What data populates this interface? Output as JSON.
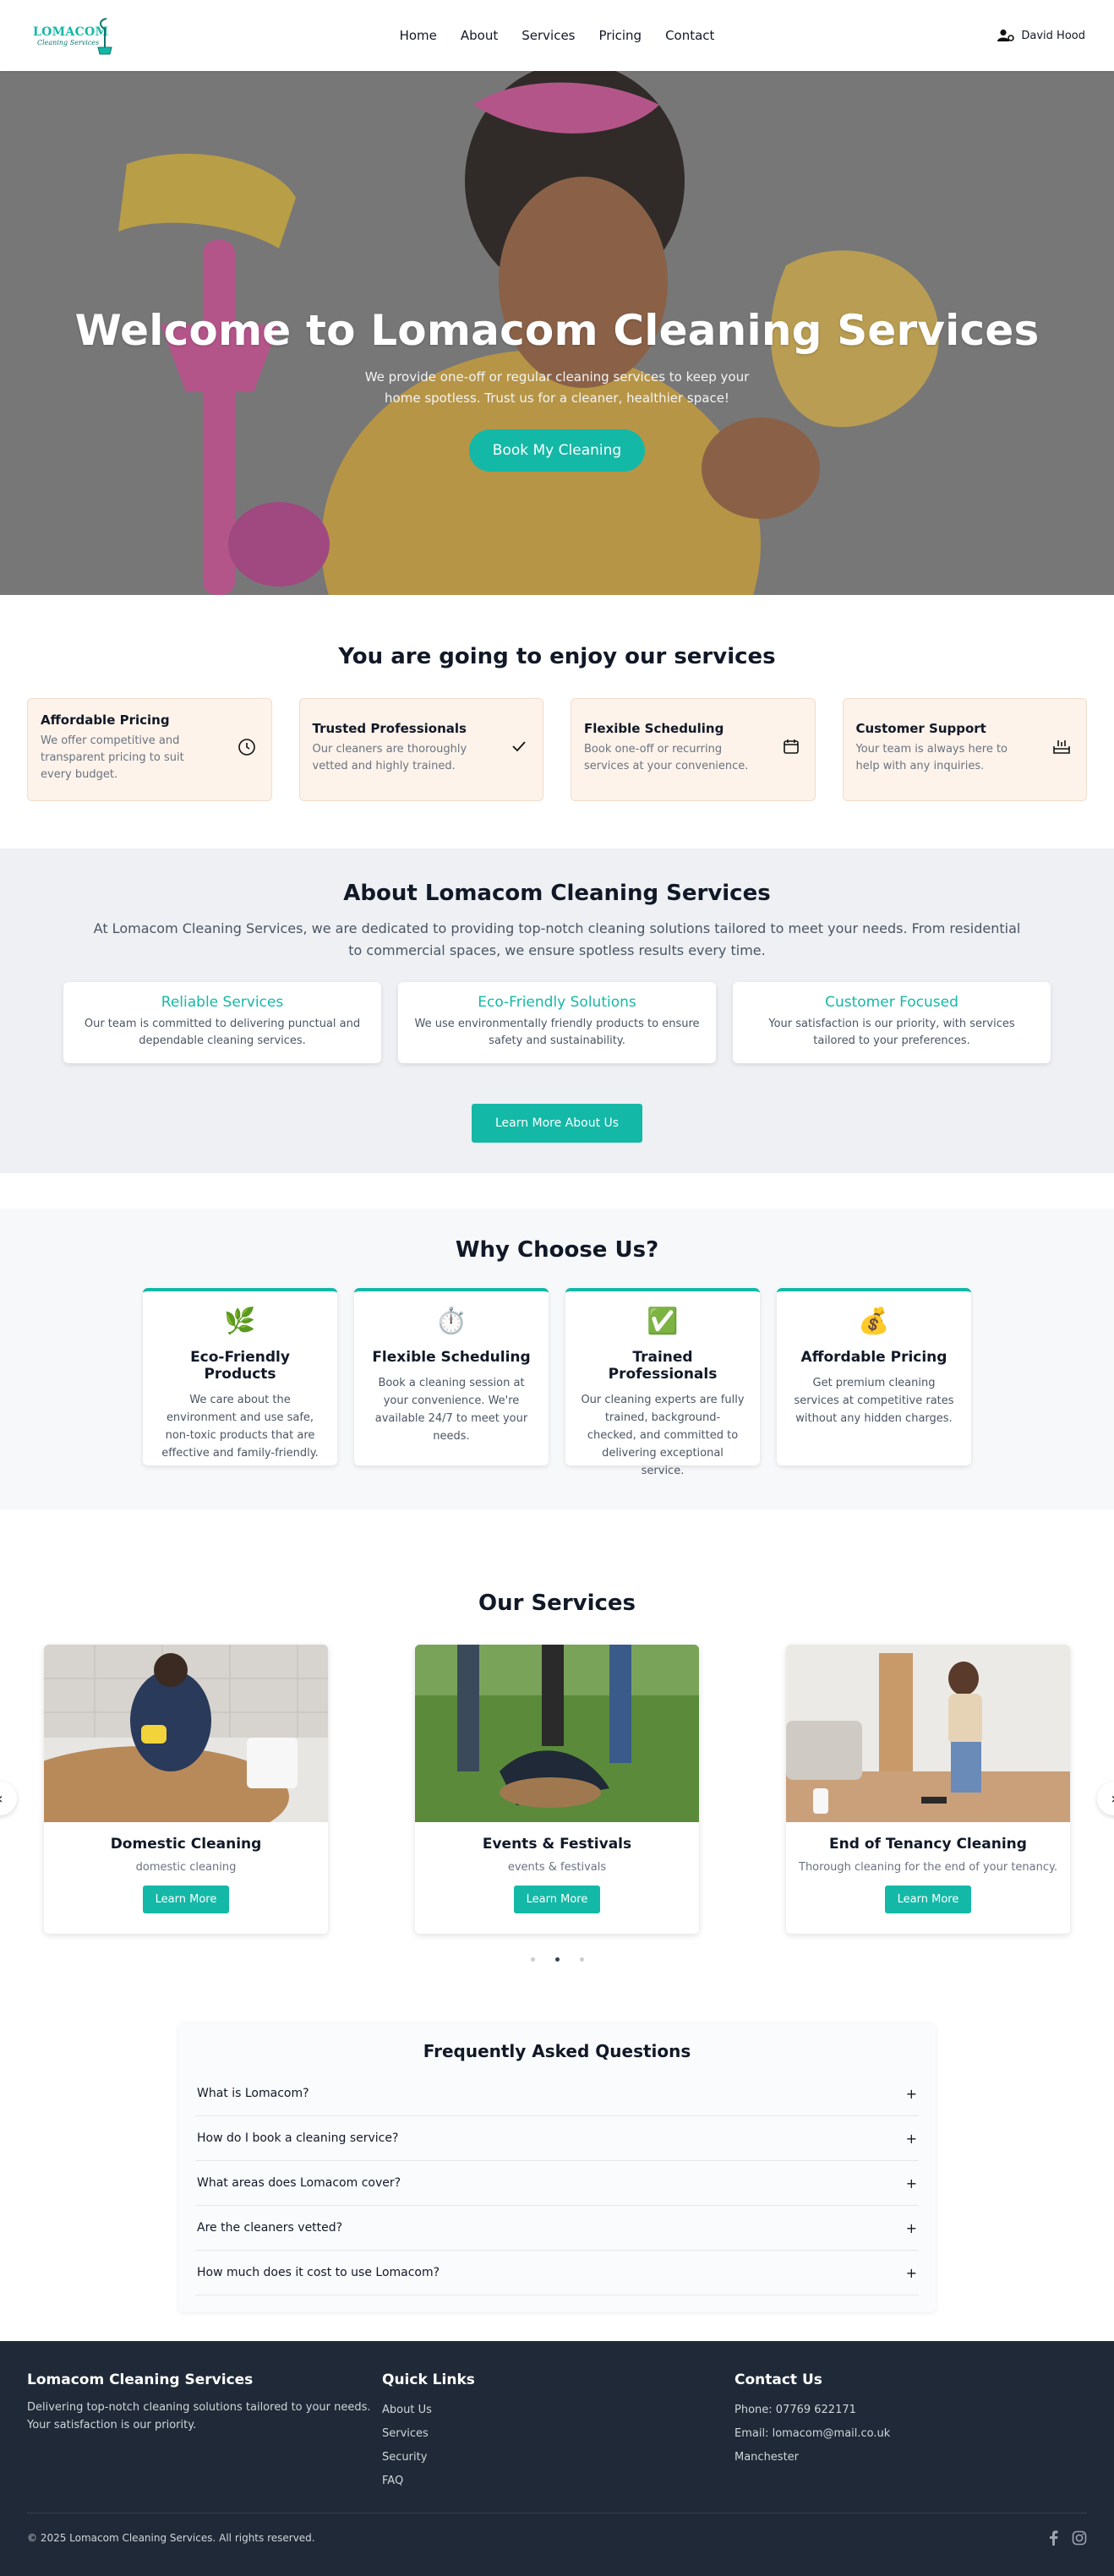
{
  "header": {
    "logo_text": "LOMACOM",
    "logo_sub": "Cleaning Services",
    "nav": [
      "Home",
      "About",
      "Services",
      "Pricing",
      "Contact"
    ],
    "user_name": "David Hood"
  },
  "hero": {
    "title": "Welcome to Lomacom Cleaning Services",
    "subtitle": "We provide one-off or regular cleaning services to keep your home spotless. Trust us for a cleaner, healthier space!",
    "cta": "Book My Cleaning"
  },
  "enjoy": {
    "title": "You are going to enjoy our services",
    "cards": [
      {
        "title": "Affordable Pricing",
        "text": "We offer competitive and transparent pricing to suit every budget.",
        "icon": "clock-icon"
      },
      {
        "title": "Trusted Professionals",
        "text": "Our cleaners are thoroughly vetted and highly trained.",
        "icon": "check-icon"
      },
      {
        "title": "Flexible Scheduling",
        "text": "Book one-off or recurring services at your convenience.",
        "icon": "calendar-icon"
      },
      {
        "title": "Customer Support",
        "text": "Your team is always here to help with any inquiries.",
        "icon": "support-icon"
      }
    ]
  },
  "about": {
    "title": "About Lomacom Cleaning Services",
    "description": "At Lomacom Cleaning Services, we are dedicated to providing top-notch cleaning solutions tailored to meet your needs. From residential to commercial spaces, we ensure spotless results every time.",
    "cards": [
      {
        "title": "Reliable Services",
        "text": "Our team is committed to delivering punctual and dependable cleaning services."
      },
      {
        "title": "Eco-Friendly Solutions",
        "text": "We use environmentally friendly products to ensure safety and sustainability."
      },
      {
        "title": "Customer Focused",
        "text": "Your satisfaction is our priority, with services tailored to your preferences."
      }
    ],
    "button": "Learn More About Us"
  },
  "why": {
    "title": "Why Choose Us?",
    "cards": [
      {
        "icon": "🌿",
        "title": "Eco-Friendly Products",
        "text": "We care about the environment and use safe, non-toxic products that are effective and family-friendly."
      },
      {
        "icon": "⏱️",
        "title": "Flexible Scheduling",
        "text": "Book a cleaning session at your convenience. We're available 24/7 to meet your needs."
      },
      {
        "icon": "✅",
        "title": "Trained Professionals",
        "text": "Our cleaning experts are fully trained, background-checked, and committed to delivering exceptional service."
      },
      {
        "icon": "💰",
        "title": "Affordable Pricing",
        "text": "Get premium cleaning services at competitive rates without any hidden charges."
      }
    ]
  },
  "services": {
    "title": "Our Services",
    "cards": [
      {
        "title": "Domestic Cleaning",
        "text": "domestic cleaning",
        "button": "Learn More"
      },
      {
        "title": "Events & Festivals",
        "text": "events & festivals",
        "button": "Learn More"
      },
      {
        "title": "End of Tenancy Cleaning",
        "text": "Thorough cleaning for the end of your tenancy.",
        "button": "Learn More"
      }
    ],
    "prev": "‹",
    "next": "›",
    "active_slide": 2
  },
  "faq": {
    "title": "Frequently Asked Questions",
    "items": [
      "What is Lomacom?",
      "How do I book a cleaning service?",
      "What areas does Lomacom cover?",
      "Are the cleaners vetted?",
      "How much does it cost to use Lomacom?"
    ],
    "toggle": "+"
  },
  "footer": {
    "brand_title": "Lomacom Cleaning Services",
    "brand_text": "Delivering top-notch cleaning solutions tailored to your needs. Your satisfaction is our priority.",
    "links_title": "Quick Links",
    "links": [
      "About Us",
      "Services",
      "Security",
      "FAQ"
    ],
    "contact_title": "Contact Us",
    "phone": "Phone: 07769 622171",
    "email": "Email: lomacom@mail.co.uk",
    "location": "Manchester",
    "copyright": "© 2025 Lomacom Cleaning Services. All rights reserved."
  },
  "colors": {
    "accent": "#14b8a6",
    "footer_bg": "#1f2937",
    "card_peach": "#fdf3ea"
  }
}
